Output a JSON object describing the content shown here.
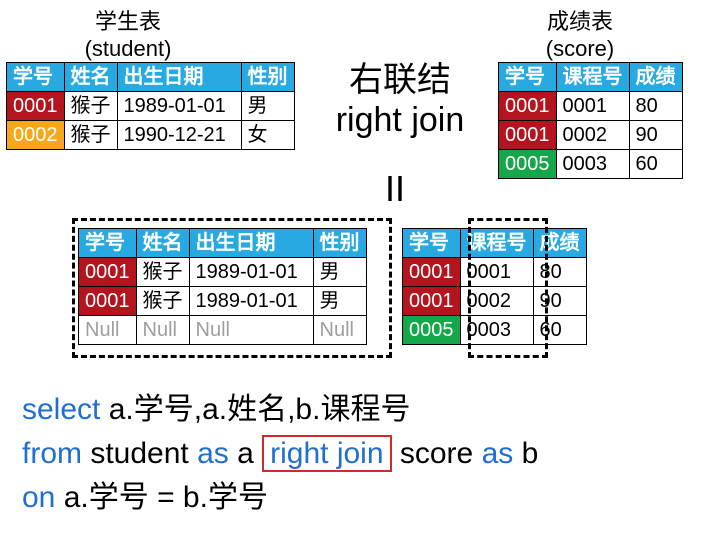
{
  "labels": {
    "student_title_cn": "学生表",
    "student_title_en": "(student)",
    "score_title_cn": "成绩表",
    "score_title_en": "(score)",
    "join_cn": "右联结",
    "join_en": "right join",
    "equals": "II"
  },
  "student_table": {
    "headers": [
      "学号",
      "姓名",
      "出生日期",
      "性别"
    ],
    "rows": [
      {
        "key": "0001",
        "color": "red",
        "name": "猴子",
        "dob": "1989-01-01",
        "sex": "男"
      },
      {
        "key": "0002",
        "color": "yellow",
        "name": "猴子",
        "dob": "1990-12-21",
        "sex": "女"
      }
    ]
  },
  "score_table": {
    "headers": [
      "学号",
      "课程号",
      "成绩"
    ],
    "rows": [
      {
        "key": "0001",
        "color": "red",
        "course": "0001",
        "score": "80"
      },
      {
        "key": "0001",
        "color": "red",
        "course": "0002",
        "score": "90"
      },
      {
        "key": "0005",
        "color": "green",
        "course": "0003",
        "score": "60"
      }
    ]
  },
  "result_student": {
    "headers": [
      "学号",
      "姓名",
      "出生日期",
      "性别"
    ],
    "rows": [
      {
        "key": "0001",
        "color": "red",
        "name": "猴子",
        "dob": "1989-01-01",
        "sex": "男"
      },
      {
        "key": "0001",
        "color": "red",
        "name": "猴子",
        "dob": "1989-01-01",
        "sex": "男"
      },
      {
        "key": "Null",
        "color": "null",
        "name": "Null",
        "dob": "Null",
        "sex": "Null"
      }
    ]
  },
  "result_score": {
    "headers": [
      "学号",
      "课程号",
      "成绩"
    ],
    "rows": [
      {
        "key": "0001",
        "color": "red",
        "course": "0001",
        "score": "80"
      },
      {
        "key": "0001",
        "color": "red",
        "course": "0002",
        "score": "90"
      },
      {
        "key": "0005",
        "color": "green",
        "course": "0003",
        "score": "60"
      }
    ]
  },
  "sql": {
    "select": "select",
    "fields": " a.学号,a.姓名,b.课程号",
    "from": "from",
    "student": " student ",
    "as": "as",
    "a_sp": " a ",
    "rightjoin": "right join",
    "score": " score ",
    "b": " b",
    "on": "on",
    "cond": " a.学号 = b.学号"
  }
}
